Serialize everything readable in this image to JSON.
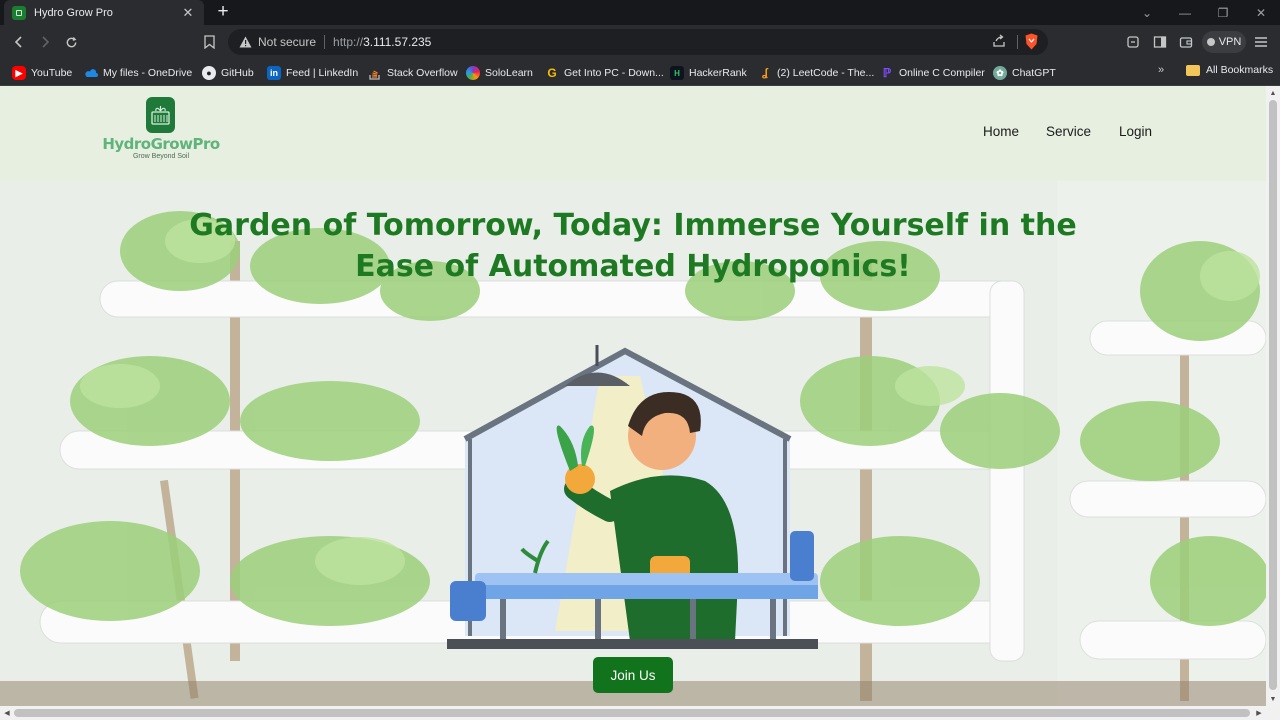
{
  "browser": {
    "tab_title": "Hydro Grow Pro",
    "new_tab_symbol": "+",
    "not_secure_label": "Not secure",
    "url_scheme": "http://",
    "url_host": "3.111.57.235",
    "vpn_label": "VPN",
    "bookmarks": [
      {
        "label": "YouTube",
        "icon": "youtube-icon",
        "color": "#ff0000"
      },
      {
        "label": "My files - OneDrive",
        "icon": "onedrive-icon",
        "color": "#1e88e5"
      },
      {
        "label": "GitHub",
        "icon": "github-icon",
        "color": "#ffffff"
      },
      {
        "label": "Feed | LinkedIn",
        "icon": "linkedin-icon",
        "color": "#0a66c2"
      },
      {
        "label": "Stack Overflow",
        "icon": "stackoverflow-icon",
        "color": "#f48024"
      },
      {
        "label": "SoloLearn",
        "icon": "sololearn-icon",
        "color": "#7f3fbf"
      },
      {
        "label": "Get Into PC - Down...",
        "icon": "google-icon",
        "color": "#fbbc05"
      },
      {
        "label": "HackerRank",
        "icon": "hackerrank-icon",
        "color": "#2ec866"
      },
      {
        "label": "(2) LeetCode - The...",
        "icon": "leetcode-icon",
        "color": "#ffa116"
      },
      {
        "label": "Online C Compiler",
        "icon": "compiler-icon",
        "color": "#7c4dff"
      },
      {
        "label": "ChatGPT",
        "icon": "chatgpt-icon",
        "color": "#74aa9c"
      }
    ],
    "bookmarks_more": "»",
    "all_bookmarks_label": "All Bookmarks"
  },
  "site": {
    "logo_text": "HydroGrowPro",
    "logo_tagline": "Grow Beyond Soil",
    "nav": [
      {
        "label": "Home"
      },
      {
        "label": "Service"
      },
      {
        "label": "Login"
      }
    ],
    "hero_title_line1": "Garden of Tomorrow, Today: Immerse Yourself in the",
    "hero_title_line2": "Ease of Automated Hydroponics!",
    "cta_label": "Join Us",
    "colors": {
      "brand_green": "#12731d",
      "title_green": "#1e7a22",
      "header_bg": "#e6efe0"
    }
  }
}
